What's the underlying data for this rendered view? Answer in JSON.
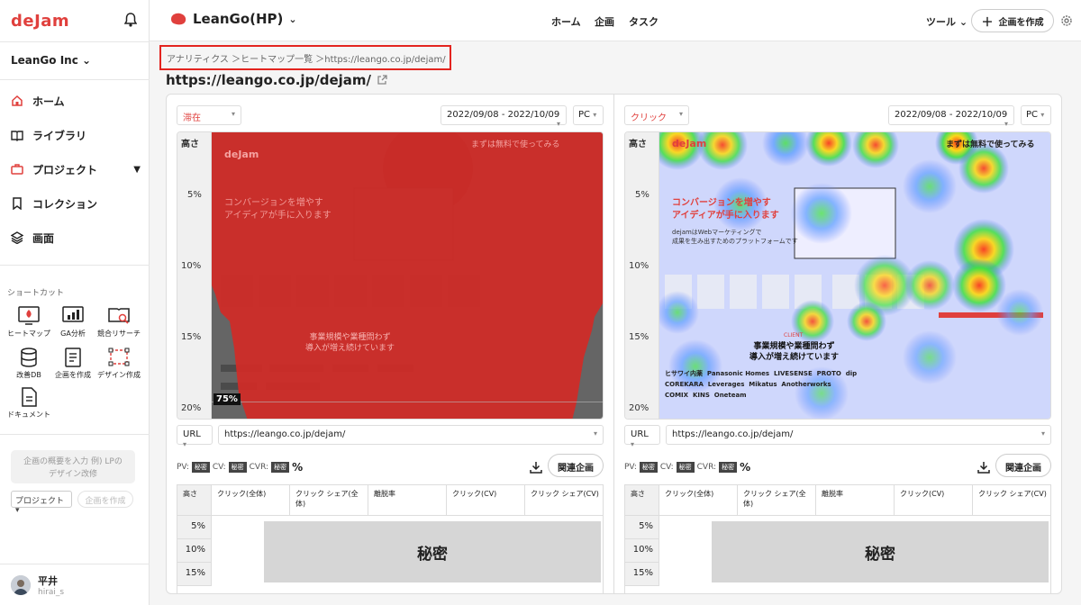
{
  "sidebar": {
    "logo": "deJam",
    "org": "LeanGo Inc",
    "nav": [
      {
        "label": "ホーム",
        "icon": "home-icon"
      },
      {
        "label": "ライブラリ",
        "icon": "book-icon"
      },
      {
        "label": "プロジェクト",
        "icon": "briefcase-icon"
      },
      {
        "label": "コレクション",
        "icon": "bookmark-icon"
      },
      {
        "label": "画面",
        "icon": "layers-icon"
      }
    ],
    "shortcut_title": "ショートカット",
    "shortcuts": [
      {
        "label": "ヒートマップ",
        "icon": "heatmap-icon"
      },
      {
        "label": "GA分析",
        "icon": "bar-chart-icon"
      },
      {
        "label": "競合リサーチ",
        "icon": "research-icon"
      },
      {
        "label": "改善DB",
        "icon": "database-icon"
      },
      {
        "label": "企画を作成",
        "icon": "plan-icon"
      },
      {
        "label": "デザイン作成",
        "icon": "design-icon"
      },
      {
        "label": "ドキュメント",
        "icon": "document-icon"
      }
    ],
    "memo_placeholder": "企画の概要を入力 例) LPのデザイン改修",
    "project_select": "プロジェクト",
    "create_plan": "企画を作成",
    "user": {
      "name": "平井",
      "id": "hirai_s"
    }
  },
  "topbar": {
    "project": "LeanGo(HP)",
    "nav": [
      "ホーム",
      "企画",
      "タスク"
    ],
    "tools": "ツール",
    "create": "企画を作成"
  },
  "breadcrumb": "アナリティクス ＞ヒートマップ一覧 ＞https://leango.co.jp/dejam/",
  "page_title": "https://leango.co.jp/dejam/",
  "panels": [
    {
      "mode": "滞在",
      "date": "2022/09/08 - 2022/10/09",
      "device": "PC",
      "height_header": "高さ",
      "height_labels": [
        "5%",
        "10%",
        "15%",
        "20%"
      ],
      "overlay_percent": "75%",
      "url_label": "URL",
      "url": "https://leango.co.jp/dejam/",
      "stats": {
        "pv": "PV:",
        "cv": "CV:",
        "cvr": "CVR:",
        "secret": "秘密",
        "unit": "%"
      },
      "related_button": "関連企画",
      "table_headers": [
        "高さ",
        "クリック(全体)",
        "クリック シェア(全体)",
        "離脱率",
        "クリック(CV)",
        "クリック シェア(CV)"
      ],
      "rows": [
        "5%",
        "10%",
        "15%"
      ],
      "secret_label": "秘密"
    },
    {
      "mode": "クリック",
      "date": "2022/09/08 - 2022/10/09",
      "device": "PC",
      "height_header": "高さ",
      "height_labels": [
        "5%",
        "10%",
        "15%",
        "20%"
      ],
      "url_label": "URL",
      "url": "https://leango.co.jp/dejam/",
      "stats": {
        "pv": "PV:",
        "cv": "CV:",
        "cvr": "CVR:",
        "secret": "秘密",
        "unit": "%"
      },
      "related_button": "関連企画",
      "table_headers": [
        "高さ",
        "クリック(全体)",
        "クリック シェア(全体)",
        "離脱率",
        "クリック(CV)",
        "クリック シェア(CV)"
      ],
      "rows": [
        "5%",
        "10%",
        "15%"
      ],
      "secret_label": "秘密"
    }
  ],
  "website": {
    "brand": "deJam",
    "cta": "まずは無料で使ってみる",
    "headline": [
      "コンバージョンを増やす",
      "アイディアが手に入ります"
    ],
    "sub": [
      "dejamはWebマーケティングで",
      "成果を生み出すためのプラットフォームです"
    ],
    "client_tag": "CLIENT",
    "client_heading": [
      "事業規模や業種問わず",
      "導入が増え続けています"
    ],
    "logos": [
      "ヒサワイ内薬",
      "Panasonic Homes",
      "LIVESENSE",
      "PROTO",
      "dip",
      "COREKARA",
      "Leverages",
      "Mikatus",
      "Anotherworks",
      "COMIX",
      "KINS",
      "Oneteam"
    ]
  },
  "colors": {
    "accent": "#e0403d",
    "highlight": "#e3241f"
  }
}
